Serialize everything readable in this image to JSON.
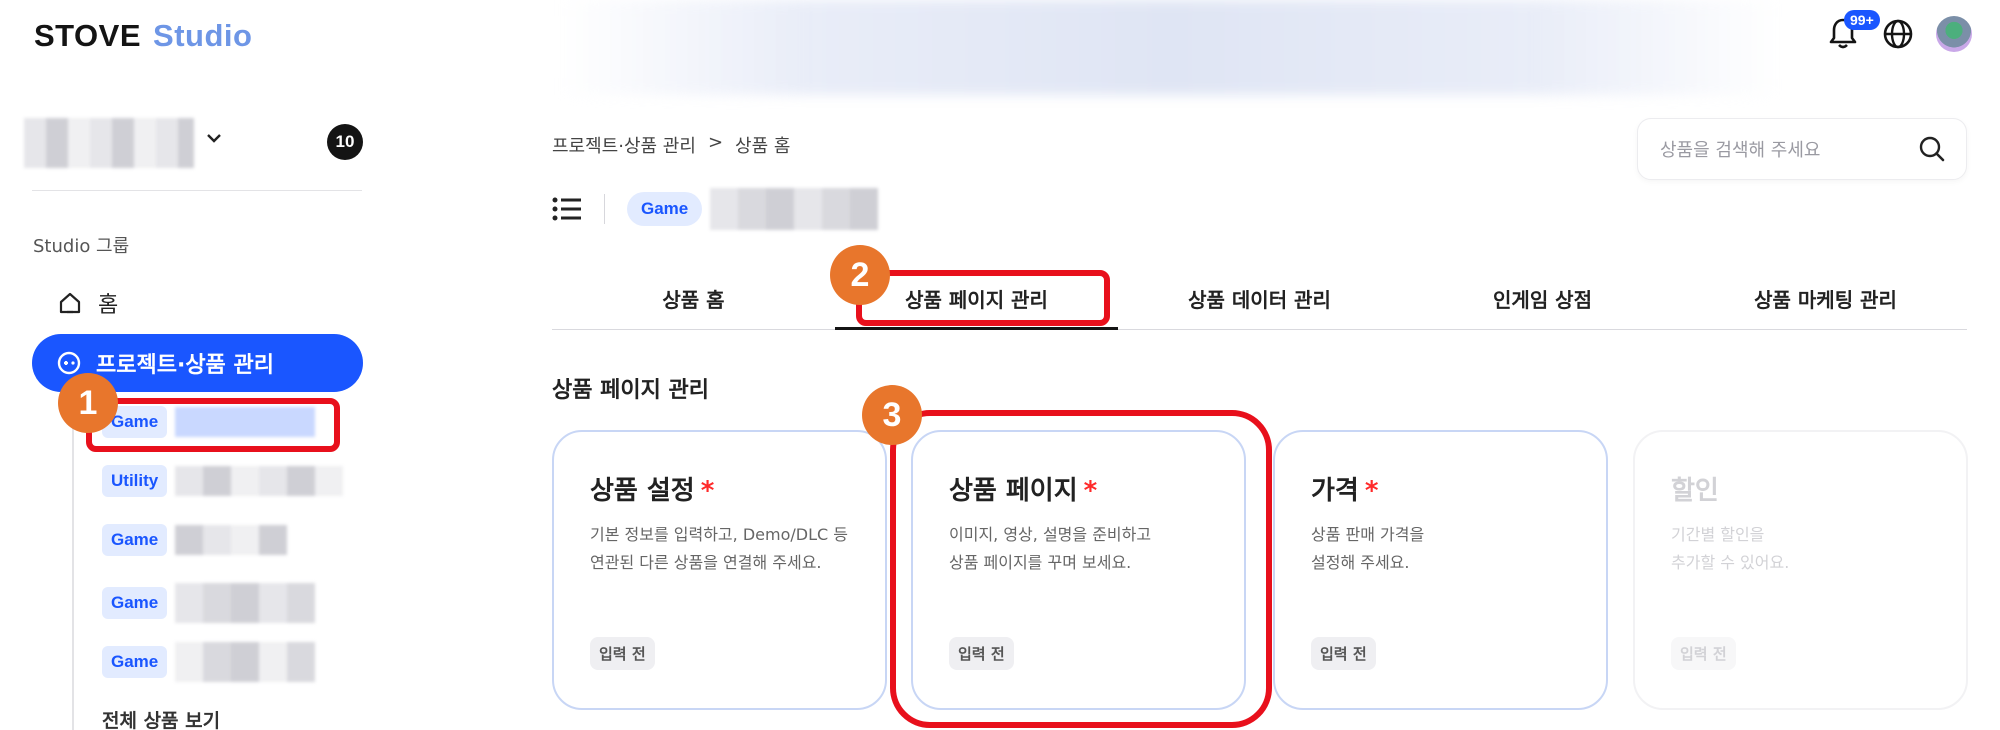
{
  "header": {
    "logo_main": "STOVE",
    "logo_sub": "Studio",
    "notification_badge": "99+"
  },
  "sidebar": {
    "project_count": "10",
    "group_label": "Studio 그룹",
    "home_label": "홈",
    "active_label": "프로젝트·상품 관리",
    "sub_items": [
      {
        "tag": "Game"
      },
      {
        "tag": "Utility"
      },
      {
        "tag": "Game"
      },
      {
        "tag": "Game"
      },
      {
        "tag": "Game"
      }
    ],
    "view_all": "전체 상품 보기"
  },
  "main": {
    "breadcrumb": [
      "프로젝트·상품 관리",
      ">",
      "상품 홈"
    ],
    "search_placeholder": "상품을 검색해 주세요",
    "product_tag": "Game",
    "tabs": [
      "상품 홈",
      "상품 페이지 관리",
      "상품 데이터 관리",
      "인게임 상점",
      "상품 마케팅 관리"
    ],
    "active_tab_index": 1,
    "section_title": "상품 페이지 관리",
    "cards": [
      {
        "title": "상품 설정",
        "required": "*",
        "desc": "기본 정보를 입력하고, Demo/DLC 등\n연관된 다른 상품을 연결해 주세요.",
        "status": "입력 전"
      },
      {
        "title": "상품 페이지",
        "required": "*",
        "desc": "이미지, 영상, 설명을 준비하고\n상품 페이지를 꾸며 보세요.",
        "status": "입력 전"
      },
      {
        "title": "가격",
        "required": "*",
        "desc": "상품 판매 가격을\n설정해 주세요.",
        "status": "입력 전"
      },
      {
        "title": "할인",
        "required": "",
        "desc": "기간별 할인을\n추가할 수 있어요.",
        "status": "입력 전"
      }
    ]
  },
  "annotations": [
    "1",
    "2",
    "3"
  ],
  "colors": {
    "accent": "#1a56ff",
    "highlight": "#e8101c",
    "step_badge": "#e8762c"
  }
}
